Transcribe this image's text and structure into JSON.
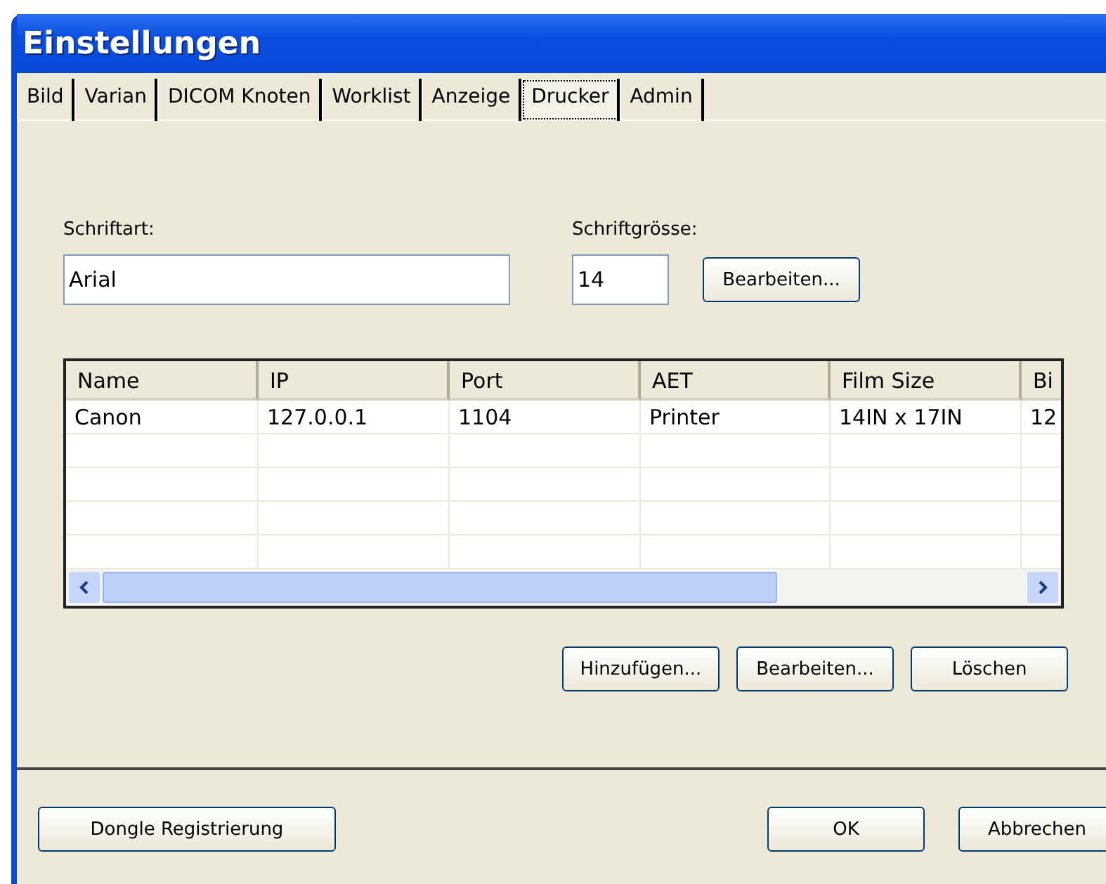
{
  "window": {
    "title": "Einstellungen"
  },
  "tabs": [
    {
      "label": "Bild",
      "selected": false
    },
    {
      "label": "Varian",
      "selected": false
    },
    {
      "label": "DICOM Knoten",
      "selected": false
    },
    {
      "label": "Worklist",
      "selected": false
    },
    {
      "label": "Anzeige",
      "selected": false
    },
    {
      "label": "Drucker",
      "selected": true
    },
    {
      "label": "Admin",
      "selected": false
    }
  ],
  "font": {
    "label": "Schriftart:",
    "value": "Arial"
  },
  "font_size": {
    "label": "Schriftgrösse:",
    "value": "14",
    "button": "Bearbeiten..."
  },
  "table": {
    "columns": [
      "Name",
      "IP",
      "Port",
      "AET",
      "Film Size",
      "Bi"
    ],
    "rows": [
      [
        "Canon",
        "127.0.0.1",
        "1104",
        "Printer",
        "14IN x 17IN",
        "12"
      ]
    ]
  },
  "table_buttons": [
    "Hinzufügen...",
    "Bearbeiten...",
    "Löschen"
  ],
  "footer": {
    "left_button": "Dongle Registrierung",
    "buttons": [
      "OK",
      "Abbrechen"
    ]
  }
}
